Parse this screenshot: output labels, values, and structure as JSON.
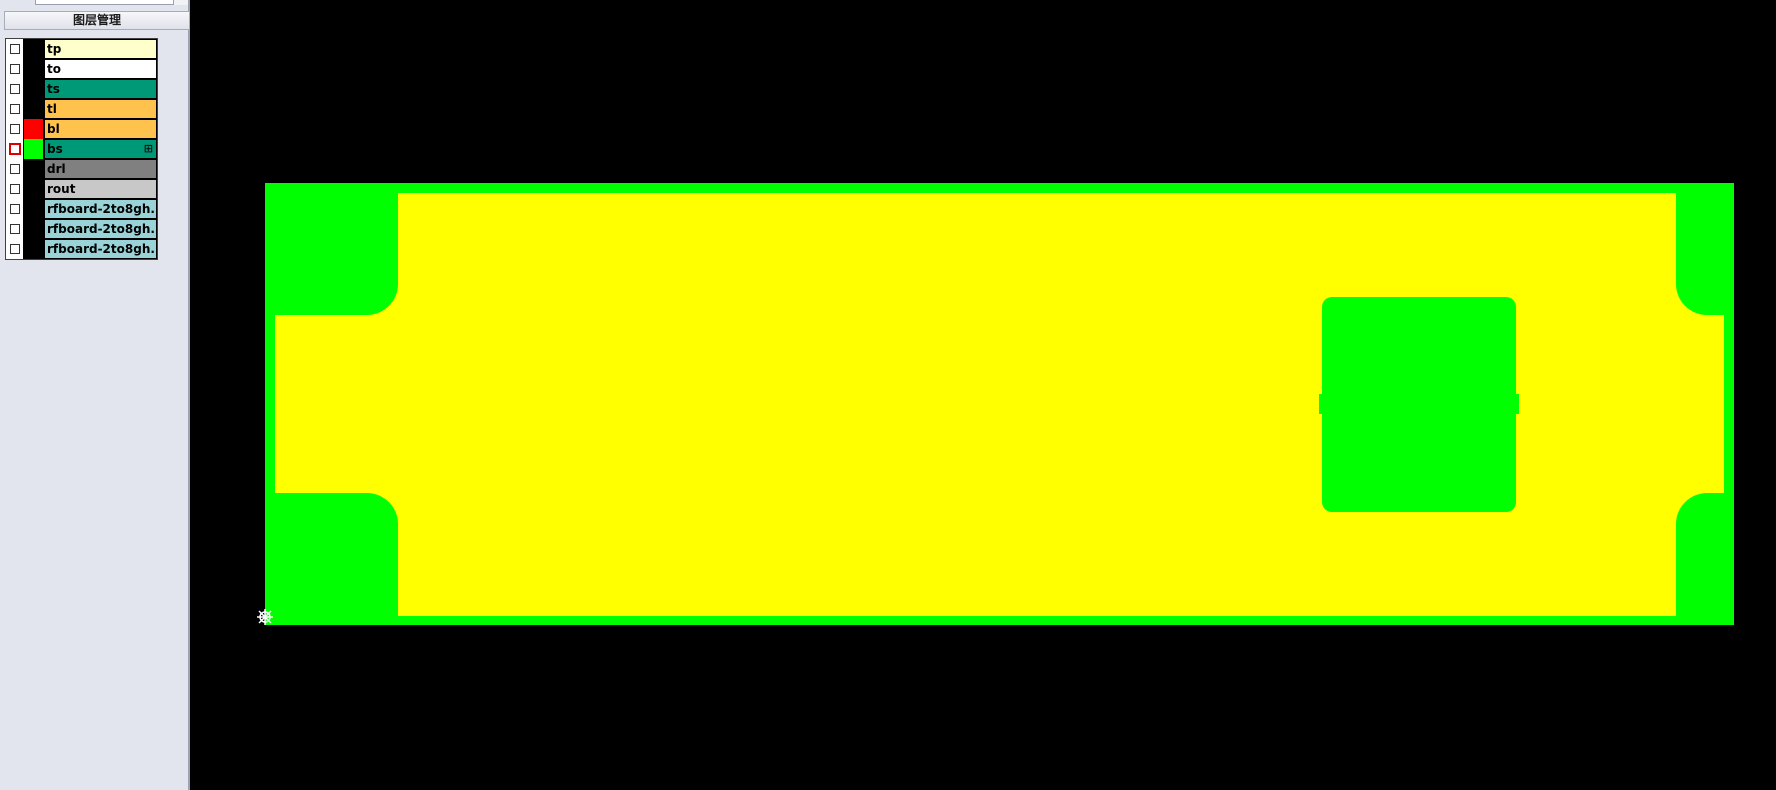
{
  "panel": {
    "title": "图层管理"
  },
  "layers": [
    {
      "name": "tp",
      "color": "#ffffcc",
      "swatch": "#000000",
      "checked": false,
      "highlighted": false
    },
    {
      "name": "to",
      "color": "#ffffff",
      "swatch": "#000000",
      "checked": false,
      "highlighted": false
    },
    {
      "name": "ts",
      "color": "#009977",
      "swatch": "#000000",
      "checked": false,
      "highlighted": false
    },
    {
      "name": "tl",
      "color": "#ffc34d",
      "swatch": "#000000",
      "checked": false,
      "highlighted": false
    },
    {
      "name": "bl",
      "color": "#ffc34d",
      "swatch": "#ff0000",
      "checked": false,
      "highlighted": false
    },
    {
      "name": "bs",
      "color": "#009977",
      "swatch": "#00ff00",
      "checked": false,
      "highlighted": true,
      "expand_icon": "⊞"
    },
    {
      "name": "drl",
      "color": "#808080",
      "swatch": "#000000",
      "checked": false,
      "highlighted": false
    },
    {
      "name": "rout",
      "color": "#c8c8c8",
      "swatch": "#000000",
      "checked": false,
      "highlighted": false
    },
    {
      "name": "rfboard-2to8gh...",
      "color": "#99d3d8",
      "swatch": "#000000",
      "checked": false,
      "highlighted": false
    },
    {
      "name": "rfboard-2to8gh...",
      "color": "#99d3d8",
      "swatch": "#000000",
      "checked": false,
      "highlighted": false
    },
    {
      "name": "rfboard-2to8gh...",
      "color": "#99d3d8",
      "swatch": "#000000",
      "checked": false,
      "highlighted": false
    }
  ],
  "canvas": {
    "background": "#000000",
    "board_color": "#00ff00",
    "copper_color": "#ffff00",
    "origin_marker_icon": "origin-crosshair-icon"
  }
}
